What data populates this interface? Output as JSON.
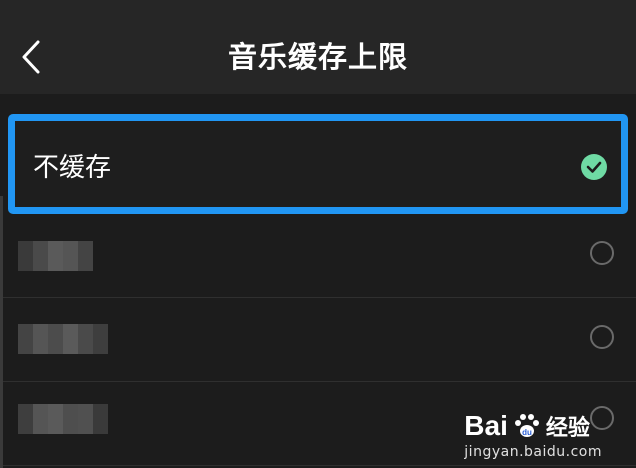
{
  "header": {
    "title": "音乐缓存上限",
    "back_icon": "chevron-left-icon"
  },
  "options": [
    {
      "label": "不缓存",
      "selected": true
    },
    {
      "label": "",
      "selected": false,
      "obscured": true
    },
    {
      "label": "",
      "selected": false,
      "obscured": true
    },
    {
      "label": "",
      "selected": false,
      "obscured": true
    }
  ],
  "colors": {
    "header_bg": "#262626",
    "page_bg": "#1c1c1c",
    "highlight_border": "#2196f3",
    "check_green": "#6fdaa4"
  },
  "watermark": {
    "brand": "Bai",
    "brand_suffix": "经验",
    "url": "jingyan.baidu.com"
  }
}
